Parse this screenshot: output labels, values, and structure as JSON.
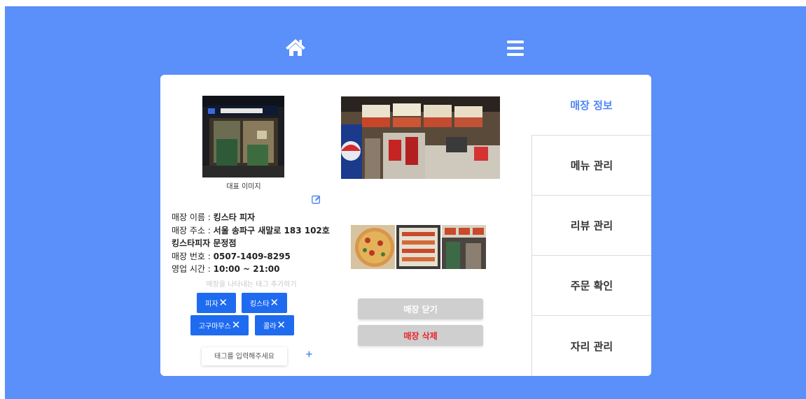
{
  "nav": {
    "home_icon": "home-icon",
    "menu_icon": "hamburger-menu-icon"
  },
  "store": {
    "rep_image_caption": "대표 이미지",
    "name_label": "매장 이름 : ",
    "name_value": "킹스타 피자",
    "address_label": "매장 주소 : ",
    "address_value_line1": "서울 송파구 새말로 183 102호",
    "address_value_line2": "킹스타피자 문정점",
    "phone_label": "매장 번호 : ",
    "phone_value": "0507-1409-8295",
    "hours_label": "영업 시간 : ",
    "hours_value": "10:00 ~ 21:00"
  },
  "tags": {
    "hint": "매장을 나타내는 태그 추가하기",
    "items": [
      "피자",
      "킹스타",
      "고구마무스",
      "콜라"
    ],
    "remove_icon": "close-x-icon",
    "input_placeholder": "태그를 입력해주세요",
    "add_label": "+"
  },
  "actions": {
    "close_store": "매장 닫기",
    "delete_store": "매장 삭제"
  },
  "sidebar": {
    "items": [
      {
        "label": "매장 정보",
        "active": true
      },
      {
        "label": "메뉴 관리",
        "active": false
      },
      {
        "label": "리뷰 관리",
        "active": false
      },
      {
        "label": "주문 확인",
        "active": false
      },
      {
        "label": "자리 관리",
        "active": false
      }
    ]
  },
  "colors": {
    "background": "#5b8ff9",
    "tag": "#1f6bf0",
    "active_menu": "#4f86f7",
    "delete_text": "#e8242a"
  }
}
